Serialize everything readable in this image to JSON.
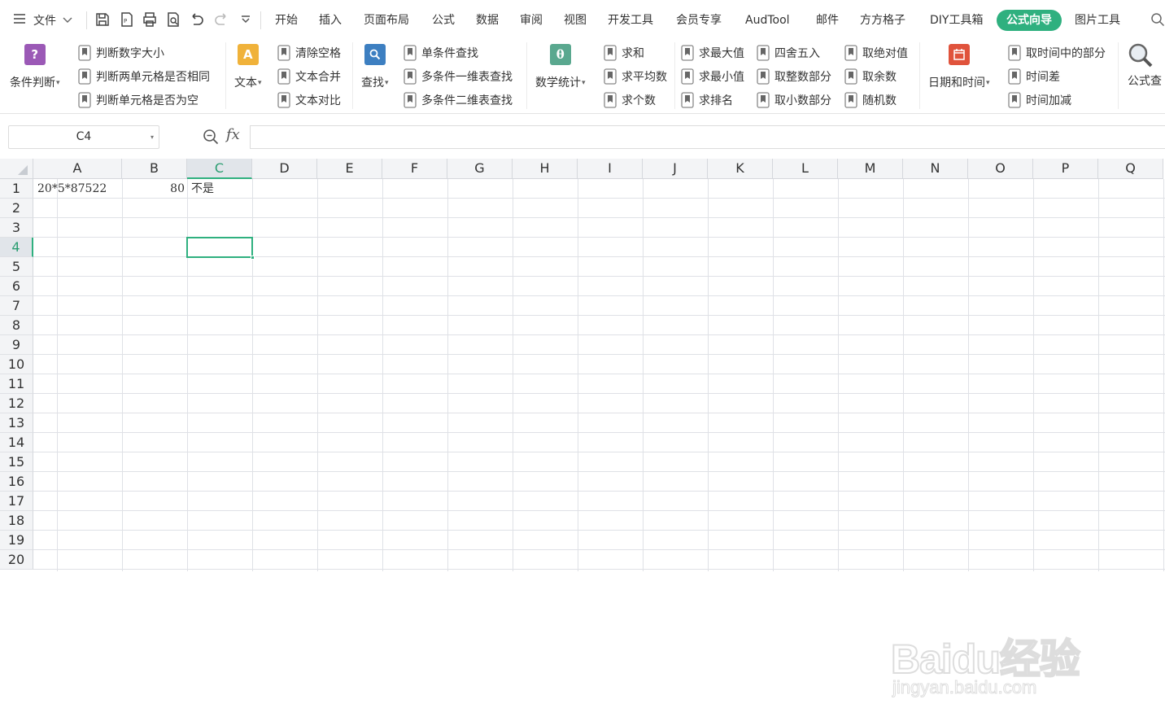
{
  "menu": {
    "file_label": "文件",
    "tabs": [
      "开始",
      "插入",
      "页面布局",
      "公式",
      "数据",
      "审阅",
      "视图",
      "开发工具",
      "会员专享",
      "AudTool",
      "邮件",
      "方方格子",
      "DIY工具箱",
      "公式向导",
      "图片工具"
    ],
    "active_tab": "公式向导",
    "accent_color": "#2fb07f"
  },
  "ribbon": {
    "condition": {
      "label": "条件判断",
      "items": [
        "判断数字大小",
        "判断两单元格是否相同",
        "判断单元格是否为空"
      ]
    },
    "text": {
      "label": "文本",
      "items": [
        "清除空格",
        "文本合并",
        "文本对比"
      ]
    },
    "lookup": {
      "label": "查找",
      "items": [
        "单条件查找",
        "多条件一维表查找",
        "多条件二维表查找"
      ]
    },
    "math": {
      "label": "数学统计",
      "col1": [
        "求和",
        "求平均数",
        "求个数"
      ],
      "col2": [
        "求最大值",
        "求最小值",
        "求排名"
      ],
      "col3": [
        "四舍五入",
        "取整数部分",
        "取小数部分"
      ],
      "col4": [
        "取绝对值",
        "取余数",
        "随机数"
      ]
    },
    "datetime": {
      "label": "日期和时间",
      "items": [
        "取时间中的部分",
        "时间差",
        "时间加减"
      ]
    },
    "formula_check": {
      "label": "公式查"
    }
  },
  "formula_bar": {
    "name_box": "C4",
    "fx_label": "fx",
    "value": ""
  },
  "sheet": {
    "columns": [
      "A",
      "B",
      "C",
      "D",
      "E",
      "F",
      "G",
      "H",
      "I",
      "J",
      "K",
      "L",
      "M",
      "N",
      "O",
      "P",
      "Q"
    ],
    "rows": [
      "1",
      "2",
      "3",
      "4",
      "5",
      "6",
      "7",
      "8",
      "9",
      "10",
      "11",
      "12",
      "13",
      "14",
      "15",
      "16",
      "17",
      "18",
      "19",
      "20"
    ],
    "selected_column": "C",
    "selected_row": "4",
    "cells": {
      "A1": "20*5*87522",
      "B1": "80",
      "C1": "不是"
    }
  },
  "watermark": {
    "logo": "Baidu经验",
    "url": "jingyan.baidu.com"
  }
}
